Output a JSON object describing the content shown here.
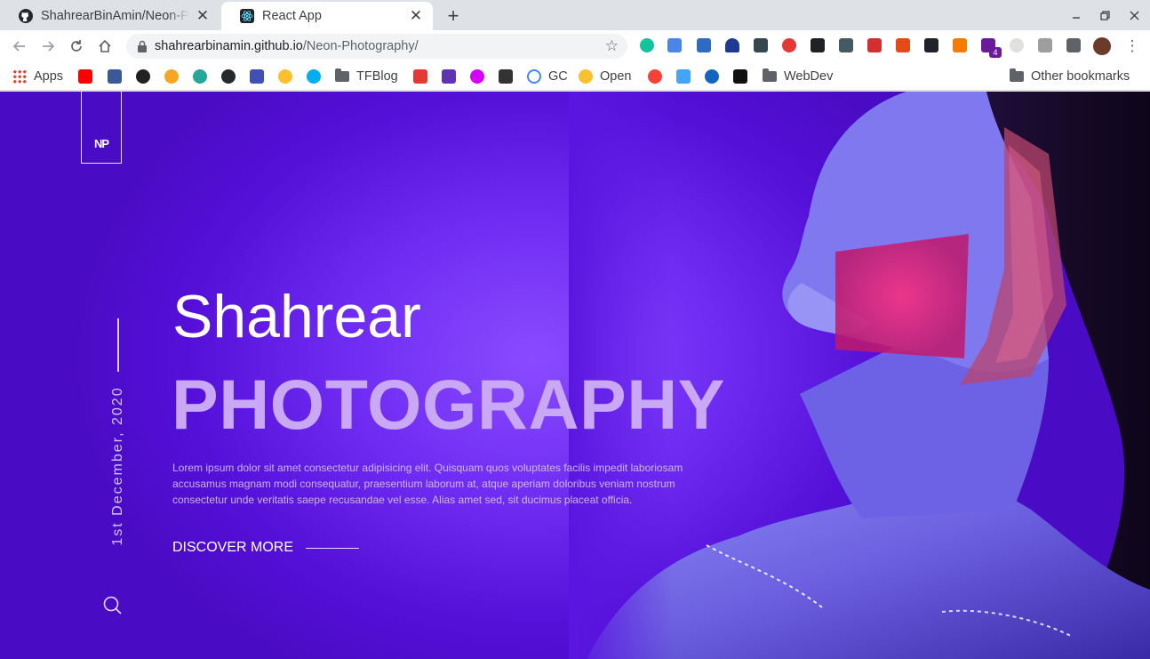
{
  "browser": {
    "tabs": [
      {
        "title": "ShahrearBinAmin/Neon-Photography",
        "icon": "github-icon",
        "active": false
      },
      {
        "title": "React App",
        "icon": "react-icon",
        "active": true
      }
    ],
    "address": {
      "host": "shahrearbinamin.github.io",
      "path": "/Neon-Photography/"
    },
    "bookmarks": {
      "apps": "Apps",
      "tfblog": "TFBlog",
      "gc": "GC",
      "open": "Open",
      "webdev": "WebDev",
      "other": "Other bookmarks"
    },
    "extension_badge": "4"
  },
  "page": {
    "logo": "NP",
    "date": "1st December, 2020",
    "name": "Shahrear",
    "headline": "PHOTOGRAPHY",
    "description": "Lorem ipsum dolor sit amet consectetur adipisicing elit. Quisquam quos voluptates facilis impedit laboriosam accusamus magnam modi consequatur, praesentium laborum at, atque aperiam doloribus veniam nostrum consectetur unde veritatis saepe recusandae vel esse. Alias amet sed, sit ducimus placeat officia.",
    "cta": "DISCOVER MORE"
  },
  "colors": {
    "background": "#5a16e0",
    "headline": "#c9a8f5",
    "accent_glow": "#8a4bff"
  }
}
